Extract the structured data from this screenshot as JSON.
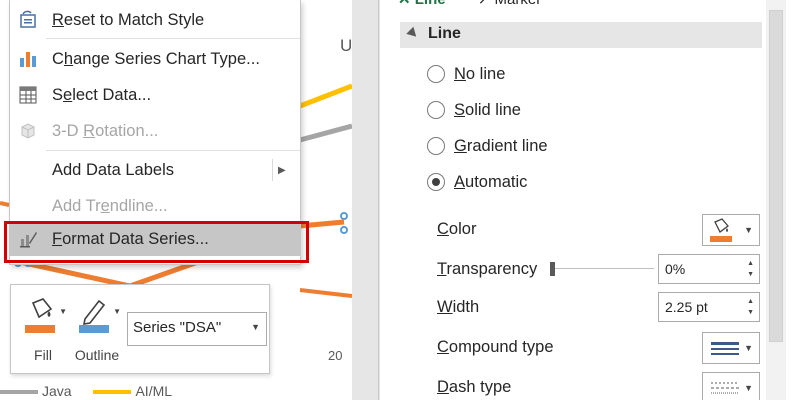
{
  "chart": {
    "title_fragment": "U",
    "axis_label": "20",
    "legend": [
      {
        "name": "Java",
        "color": "#a5a5a5"
      },
      {
        "name": "AI/ML",
        "color": "#ffc000"
      }
    ],
    "series_colors": {
      "dsa": "#ed7d31",
      "ai_ml": "#ffc000",
      "java": "#a5a5a5"
    }
  },
  "context_menu": {
    "items": [
      {
        "label": "Reset to Match Style",
        "icon": "reset-style-icon",
        "enabled": true
      },
      {
        "label": "Change Series Chart Type...",
        "icon": "chart-type-icon",
        "enabled": true
      },
      {
        "label": "Select Data...",
        "icon": "select-data-icon",
        "enabled": true
      },
      {
        "label": "3-D Rotation...",
        "icon": "rotation-3d-icon",
        "enabled": false
      },
      {
        "label": "Add Data Labels",
        "icon": "",
        "enabled": true,
        "submenu": true
      },
      {
        "label": "Add Trendline...",
        "icon": "",
        "enabled": false
      },
      {
        "label": "Format Data Series...",
        "icon": "format-series-icon",
        "enabled": true,
        "selected": true
      }
    ]
  },
  "mini_toolbar": {
    "fill_label": "Fill",
    "outline_label": "Outline",
    "series_value": "Series \"DSA\"",
    "fill_color": "#ed7d31",
    "outline_color": "#5b9bd5"
  },
  "format_pane": {
    "tabs": [
      "Line",
      "Marker"
    ],
    "section_title": "Line",
    "line_options": [
      {
        "label": "No line",
        "checked": false
      },
      {
        "label": "Solid line",
        "checked": false
      },
      {
        "label": "Gradient line",
        "checked": false
      },
      {
        "label": "Automatic",
        "checked": true
      }
    ],
    "props": {
      "color_label": "Color",
      "transparency_label": "Transparency",
      "transparency_value": "0%",
      "width_label": "Width",
      "width_value": "2.25 pt",
      "compound_label": "Compound type",
      "dash_label": "Dash type"
    },
    "accent_color": "#217346",
    "line_color": "#ed7d31"
  }
}
